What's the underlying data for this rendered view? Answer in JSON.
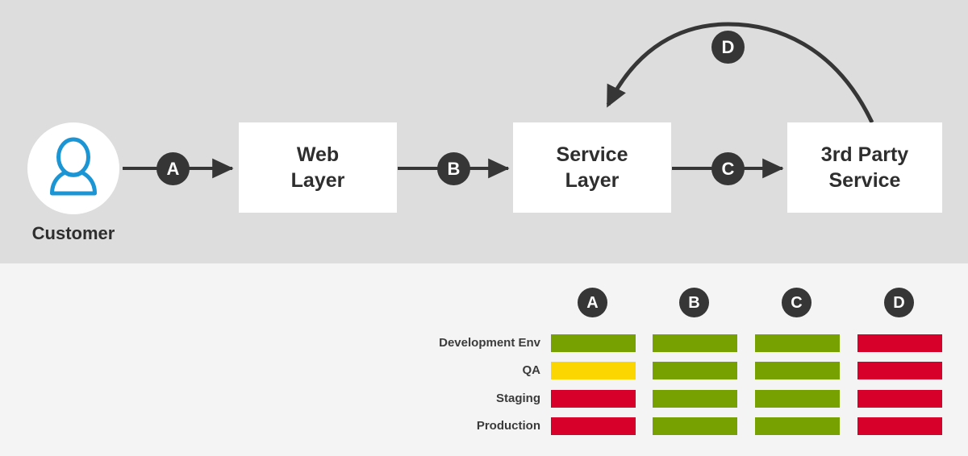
{
  "diagram": {
    "title_hidden": "",
    "actor": {
      "label": "Customer",
      "icon": "user-icon"
    },
    "nodes": [
      {
        "id": "web-layer",
        "line1": "Web",
        "line2": "Layer"
      },
      {
        "id": "service-layer",
        "line1": "Service",
        "line2": "Layer"
      },
      {
        "id": "third-party-service",
        "line1": "3rd Party",
        "line2": "Service"
      }
    ],
    "connectors": [
      {
        "id": "A",
        "label": "A",
        "from": "Customer",
        "to": "Web Layer"
      },
      {
        "id": "B",
        "label": "B",
        "from": "Web Layer",
        "to": "Service Layer"
      },
      {
        "id": "C",
        "label": "C",
        "from": "Service Layer",
        "to": "3rd Party Service"
      },
      {
        "id": "D",
        "label": "D",
        "from": "3rd Party Service",
        "to": "Service Layer"
      }
    ]
  },
  "matrix": {
    "columns": [
      "A",
      "B",
      "C",
      "D"
    ],
    "rows": [
      {
        "label": "Development Env",
        "statuses": [
          "green",
          "green",
          "green",
          "red"
        ]
      },
      {
        "label": "QA",
        "statuses": [
          "yellow",
          "green",
          "green",
          "red"
        ]
      },
      {
        "label": "Staging",
        "statuses": [
          "red",
          "green",
          "green",
          "red"
        ]
      },
      {
        "label": "Production",
        "statuses": [
          "red",
          "green",
          "green",
          "red"
        ]
      }
    ]
  },
  "colors": {
    "green": "#76a100",
    "yellow": "#fbd600",
    "red": "#d6002b",
    "badge": "#363636",
    "accent_blue": "#1b95d4",
    "band_top": "#dddddd",
    "band_bottom": "#f4f4f4",
    "box_fill": "#ffffff",
    "text_dark": "#2e2e2e"
  }
}
